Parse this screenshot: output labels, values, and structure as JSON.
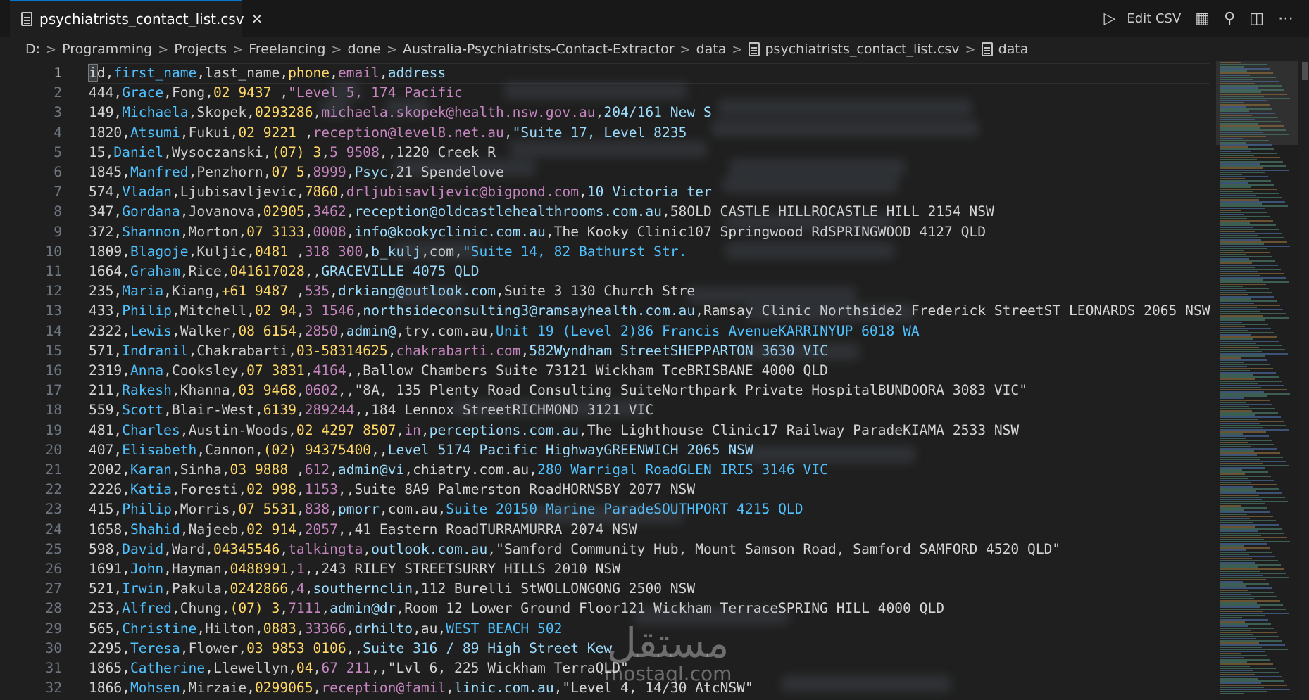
{
  "tab": {
    "title": "psychiatrists_contact_list.csv",
    "close": "✕"
  },
  "actions": {
    "edit_csv": "Edit CSV"
  },
  "breadcrumb": [
    "D:",
    "Programming",
    "Projects",
    "Freelancing",
    "done",
    "Australia-Psychiatrists-Contact-Extractor",
    "data",
    "psychiatrists_contact_list.csv",
    "data"
  ],
  "editor": {
    "lines": [
      {
        "n": "1",
        "segs": [
          "id",
          ",",
          "first_name",
          ",",
          "last_name",
          ",",
          "phone",
          ",",
          "email",
          ",",
          "address"
        ]
      },
      {
        "n": "2",
        "segs": [
          "444",
          ",",
          "Grace",
          ",",
          "Fong",
          ",",
          "02 9437 ",
          ",",
          "\"Level 5, 174 Pacific"
        ]
      },
      {
        "n": "3",
        "segs": [
          "149",
          ",",
          "Michaela",
          ",",
          "Skopek",
          ",",
          "0293286",
          ",",
          "michaela.skopek@health.nsw.gov.au",
          ",",
          "204/161 New S"
        ]
      },
      {
        "n": "4",
        "segs": [
          "1820",
          ",",
          "Atsumi",
          ",",
          "Fukui",
          ",",
          "02 9221 ",
          ",",
          "reception@level8.net.au",
          ",",
          "\"Suite 17, Level 8235"
        ]
      },
      {
        "n": "5",
        "segs": [
          "15",
          ",",
          "Daniel",
          ",",
          "Wysoczanski",
          ",",
          "(07) 3",
          ",",
          "5 9508",
          ",",
          ",",
          "1220 Creek R"
        ]
      },
      {
        "n": "6",
        "segs": [
          "1845",
          ",",
          "Manfred",
          ",",
          "Penzhorn",
          ",",
          "07 5",
          ",",
          "8999",
          ",",
          "Psyc",
          ",",
          "21 Spendelove"
        ]
      },
      {
        "n": "7",
        "segs": [
          "574",
          ",",
          "Vladan",
          ",",
          "Ljubisavljevic",
          ",",
          "7860",
          ",",
          "drljubisavljevic@bigpond.com",
          ",",
          "10 Victoria ter"
        ]
      },
      {
        "n": "8",
        "segs": [
          "347",
          ",",
          "Gordana",
          ",",
          "Jovanova",
          ",",
          "02905",
          ",",
          "3462",
          ",",
          "reception@oldcastlehealthrooms.com.au",
          ",",
          "58OLD CASTLE HILLROCASTLE HILL 2154 NSW"
        ]
      },
      {
        "n": "9",
        "segs": [
          "372",
          ",",
          "Shannon",
          ",",
          "Morton",
          ",",
          "07 3133",
          ",",
          "0008",
          ",",
          "info@kookyclinic.com.au",
          ",",
          "The Kooky Clinic107 Springwood RdSPRINGWOOD 4127 QLD"
        ]
      },
      {
        "n": "10",
        "segs": [
          "1809",
          ",",
          "Blagoje",
          ",",
          "Kuljic",
          ",",
          "0481 ",
          ",",
          "318 300",
          ",",
          "b_kulj",
          ",",
          "com",
          ",",
          "\"Suite 14, 82 Bathurst Str."
        ]
      },
      {
        "n": "11",
        "segs": [
          "1664",
          ",",
          "Graham",
          ",",
          "Rice",
          ",",
          "041617028",
          ",",
          ",",
          "GRACEVILLE 4075 QLD"
        ]
      },
      {
        "n": "12",
        "segs": [
          "235",
          ",",
          "Maria",
          ",",
          "Kiang",
          ",",
          "+61 9487 ",
          ",",
          "535",
          ",",
          "drkiang@outlook.com",
          ",",
          "Suite 3 130 Church Stre"
        ]
      },
      {
        "n": "13",
        "segs": [
          "433",
          ",",
          "Philip",
          ",",
          "Mitchell",
          ",",
          "02 94",
          ",",
          "3 1546",
          ",",
          "northsideconsulting3@ramsayhealth.com.au",
          ",",
          "Ramsay Clinic Northside2 Frederick StreetST LEONARDS 2065 NSW"
        ]
      },
      {
        "n": "14",
        "segs": [
          "2322",
          ",",
          "Lewis",
          ",",
          "Walker",
          ",",
          "08 6154",
          ",",
          "2850",
          ",",
          "admin@",
          ",",
          "try.com.au",
          ",",
          "Unit 19 (Level 2)86 Francis AvenueKARRINYUP 6018 WA"
        ]
      },
      {
        "n": "15",
        "segs": [
          "571",
          ",",
          "Indranil",
          ",",
          "Chakrabarti",
          ",",
          "03-58314625",
          ",",
          "chakrabarti.com",
          ",",
          "582Wyndham StreetSHEPPARTON 3630 VIC"
        ]
      },
      {
        "n": "16",
        "segs": [
          "2319",
          ",",
          "Anna",
          ",",
          "Cooksley",
          ",",
          "07 3831",
          ",",
          "4164",
          ",",
          ",",
          "Ballow Chambers Suite 73121 Wickham TceBRISBANE 4000 QLD"
        ]
      },
      {
        "n": "17",
        "segs": [
          "211",
          ",",
          "Rakesh",
          ",",
          "Khanna",
          ",",
          "03 9468",
          ",",
          "0602",
          ",",
          ",",
          "\"8A, 135 Plenty Road Consulting SuiteNorthpark Private HospitalBUNDOORA 3083 VIC\""
        ]
      },
      {
        "n": "18",
        "segs": [
          "559",
          ",",
          "Scott",
          ",",
          "Blair-West",
          ",",
          "6139",
          ",",
          "289244",
          ",",
          ",",
          "184 Lennox StreetRICHMOND 3121 VIC"
        ]
      },
      {
        "n": "19",
        "segs": [
          "481",
          ",",
          "Charles",
          ",",
          "Austin-Woods",
          ",",
          "02 4297 8507",
          ",",
          "in",
          ",",
          "perceptions.com.au",
          ",",
          "The Lighthouse Clinic17 Railway ParadeKIAMA 2533 NSW"
        ]
      },
      {
        "n": "20",
        "segs": [
          "407",
          ",",
          "Elisabeth",
          ",",
          "Cannon",
          ",",
          "(02) 94375400",
          ",",
          ",",
          "Level 5174 Pacific HighwayGREENWICH 2065 NSW"
        ]
      },
      {
        "n": "21",
        "segs": [
          "2002",
          ",",
          "Karan",
          ",",
          "Sinha",
          ",",
          "03 9888 ",
          ",",
          "612",
          ",",
          "admin@vi",
          ",",
          "chiatry.com.au",
          ",",
          "280 Warrigal RoadGLEN IRIS 3146 VIC"
        ]
      },
      {
        "n": "22",
        "segs": [
          "2226",
          ",",
          "Katia",
          ",",
          "Foresti",
          ",",
          "02 998",
          ",",
          "1153",
          ",",
          ",",
          "Suite 8A9 Palmerston RoadHORNSBY 2077 NSW"
        ]
      },
      {
        "n": "23",
        "segs": [
          "415",
          ",",
          "Philip",
          ",",
          "Morris",
          ",",
          "07 5531",
          ",",
          "838",
          ",",
          "pmorr",
          ",",
          "com.au",
          ",",
          "Suite 20150 Marine ParadeSOUTHPORT 4215 QLD"
        ]
      },
      {
        "n": "24",
        "segs": [
          "1658",
          ",",
          "Shahid",
          ",",
          "Najeeb",
          ",",
          "02 914",
          ",",
          "2057",
          ",",
          ",",
          "41 Eastern RoadTURRAMURRA 2074 NSW"
        ]
      },
      {
        "n": "25",
        "segs": [
          "598",
          ",",
          "David",
          ",",
          "Ward",
          ",",
          "04345546",
          ",",
          "talkingta",
          ",",
          "outlook.com.au",
          ",",
          "\"Samford Community Hub, Mount Samson Road, Samford SAMFORD 4520 QLD\""
        ]
      },
      {
        "n": "26",
        "segs": [
          "1691",
          ",",
          "John",
          ",",
          "Hayman",
          ",",
          "0488991",
          ",",
          "1",
          ",",
          ",",
          "243 RILEY STREETSURRY HILLS 2010 NSW"
        ]
      },
      {
        "n": "27",
        "segs": [
          "521",
          ",",
          "Irwin",
          ",",
          "Pakula",
          ",",
          "0242866",
          ",",
          "4",
          ",",
          "southernclin",
          ",",
          "112 Burelli StWOLLONGONG 2500 NSW"
        ]
      },
      {
        "n": "28",
        "segs": [
          "253",
          ",",
          "Alfred",
          ",",
          "Chung",
          ",",
          "(07) 3",
          ",",
          "7111",
          ",",
          "admin@dr",
          ",",
          "Room 12 Lower Ground Floor121 Wickham TerraceSPRING HILL 4000 QLD"
        ]
      },
      {
        "n": "29",
        "segs": [
          "565",
          ",",
          "Christine",
          ",",
          "Hilton",
          ",",
          "0883",
          ",",
          "33366",
          ",",
          "drhilto",
          ",",
          "au",
          ",",
          "WEST BEACH 502"
        ]
      },
      {
        "n": "30",
        "segs": [
          "2295",
          ",",
          "Teresa",
          ",",
          "Flower",
          ",",
          "03 9853 0106",
          ",",
          ",",
          "Suite 316 / 89 High Street Kew"
        ]
      },
      {
        "n": "31",
        "segs": [
          "1865",
          ",",
          "Catherine",
          ",",
          "Llewellyn",
          ",",
          "04",
          ",",
          "67 211",
          ",",
          ",",
          "\"Lvl 6, 225 Wickham Terra",
          "QLD\""
        ]
      },
      {
        "n": "32",
        "segs": [
          "1866",
          ",",
          "Mohsen",
          ",",
          "Mirzaie",
          ",",
          "0299065",
          ",",
          "reception@famil",
          ",",
          "linic.com.au",
          ",",
          "\"Level 4, 14/30 Atc",
          "NSW\""
        ]
      }
    ]
  },
  "watermark": {
    "arabic": "مستقل",
    "latin": "mostaql.com"
  }
}
